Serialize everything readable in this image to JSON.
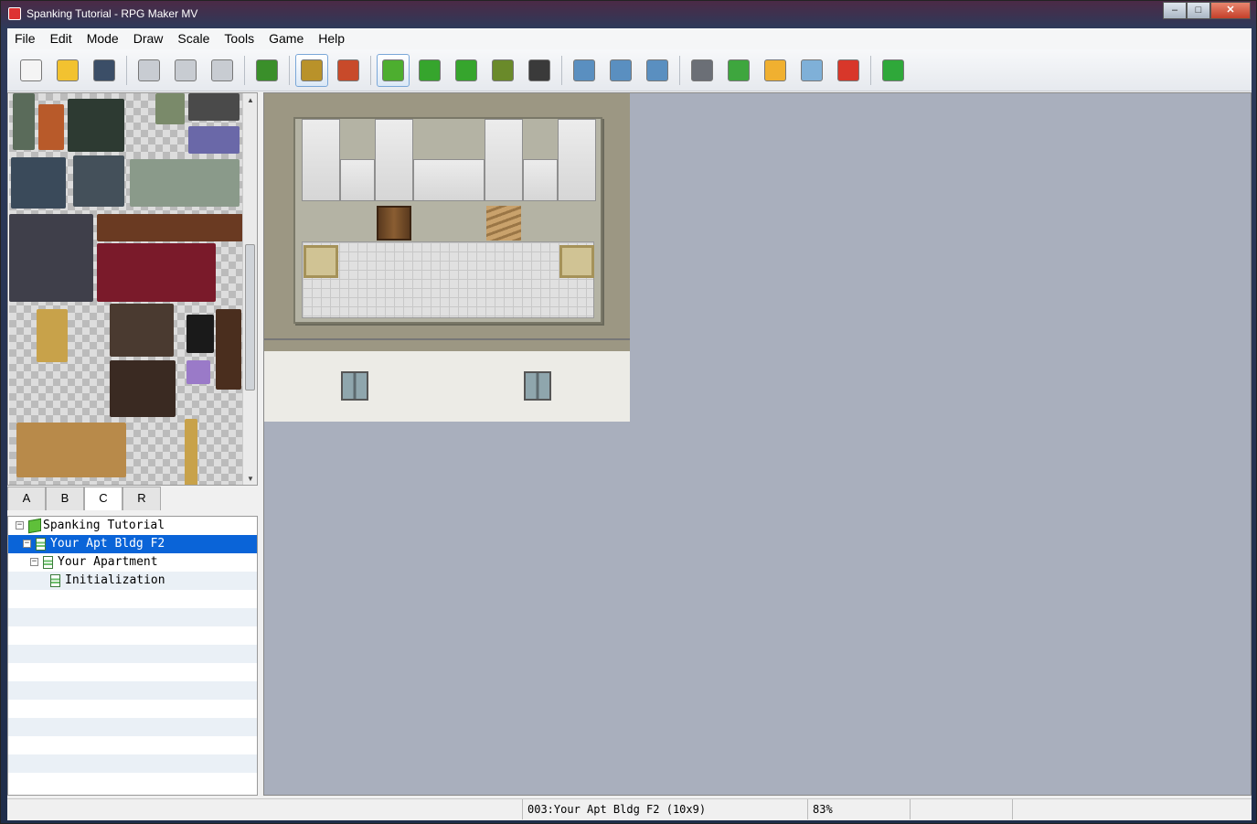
{
  "window": {
    "title": "Spanking Tutorial - RPG Maker MV",
    "minimize_glyph": "–",
    "maximize_glyph": "□",
    "close_glyph": "✕"
  },
  "menu": [
    "File",
    "Edit",
    "Mode",
    "Draw",
    "Scale",
    "Tools",
    "Game",
    "Help"
  ],
  "toolbar": {
    "groups": [
      [
        {
          "name": "new-project-icon",
          "color": "#f4f4f4"
        },
        {
          "name": "open-project-icon",
          "color": "#f2c230"
        },
        {
          "name": "save-project-icon",
          "color": "#3b4e67"
        }
      ],
      [
        {
          "name": "cut-icon",
          "color": "#c8ccd2"
        },
        {
          "name": "copy-icon",
          "color": "#c8ccd2"
        },
        {
          "name": "paste-icon",
          "color": "#c8ccd2"
        }
      ],
      [
        {
          "name": "undo-icon",
          "color": "#3a8f2a"
        }
      ],
      [
        {
          "name": "map-mode-icon",
          "color": "#b9922a",
          "active": true
        },
        {
          "name": "event-mode-icon",
          "color": "#c84a2a"
        }
      ],
      [
        {
          "name": "pencil-icon",
          "color": "#4dae2f",
          "active": true
        },
        {
          "name": "rectangle-icon",
          "color": "#36a52d"
        },
        {
          "name": "ellipse-icon",
          "color": "#36a52d"
        },
        {
          "name": "flood-fill-icon",
          "color": "#6a8a2a"
        },
        {
          "name": "shadow-pen-icon",
          "color": "#3a3a3a"
        }
      ],
      [
        {
          "name": "zoom-in-icon",
          "color": "#5a8fc0"
        },
        {
          "name": "zoom-out-icon",
          "color": "#5a8fc0"
        },
        {
          "name": "zoom-actual-icon",
          "color": "#5a8fc0"
        }
      ],
      [
        {
          "name": "database-icon",
          "color": "#6b6f76"
        },
        {
          "name": "plugin-manager-icon",
          "color": "#3ea63e"
        },
        {
          "name": "sound-test-icon",
          "color": "#f0b030"
        },
        {
          "name": "event-searcher-icon",
          "color": "#7fb0d8"
        },
        {
          "name": "character-generator-icon",
          "color": "#d8372a"
        }
      ],
      [
        {
          "name": "playtest-icon",
          "color": "#2fa83a"
        }
      ]
    ]
  },
  "tileset_tabs": {
    "items": [
      "A",
      "B",
      "C",
      "R"
    ],
    "active": "C"
  },
  "map_tree": {
    "nodes": [
      {
        "label": "Spanking Tutorial",
        "type": "project",
        "depth": 0,
        "expander": "⊟",
        "selected": false
      },
      {
        "label": "Your Apt Bldg F2",
        "type": "map",
        "depth": 1,
        "expander": "⊟",
        "selected": true
      },
      {
        "label": "Your Apartment",
        "type": "map",
        "depth": 2,
        "expander": "⊟",
        "selected": false
      },
      {
        "label": "Initialization",
        "type": "map",
        "depth": 3,
        "expander": "",
        "selected": false
      }
    ]
  },
  "statusbar": {
    "map_info": "003:Your Apt Bldg F2 (10x9)",
    "zoom": "83%"
  }
}
